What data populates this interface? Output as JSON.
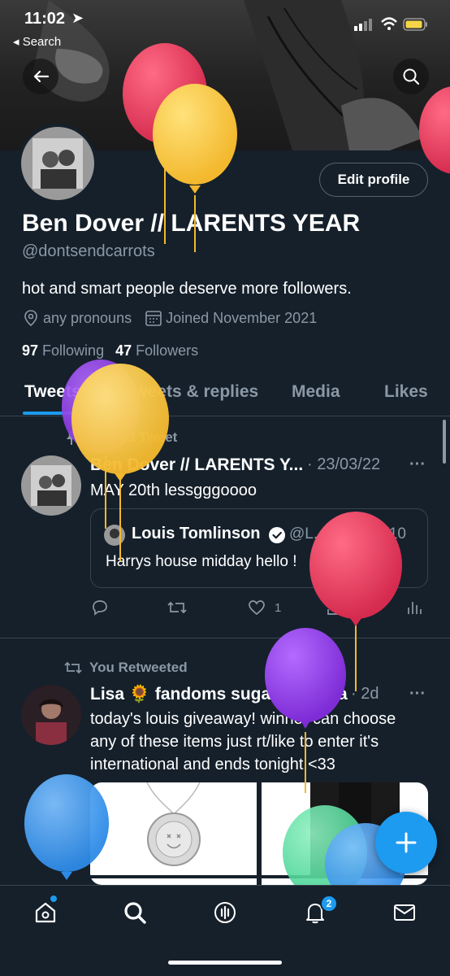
{
  "status": {
    "time": "11:02",
    "back_label": "◂ Search"
  },
  "profile": {
    "edit_button": "Edit profile",
    "name": "Ben Dover // LARENTS YEAR",
    "handle": "@dontsendcarrots",
    "bio": "hot and smart people deserve more followers.",
    "location": "any pronouns",
    "joined": "Joined November 2021",
    "following_count": "97",
    "following_label": "Following",
    "followers_count": "47",
    "followers_label": "Followers"
  },
  "tabs": [
    "Tweets",
    "Tweets & replies",
    "Media",
    "Likes"
  ],
  "tweets": [
    {
      "context": "Pinned Tweet",
      "author": "Ben Dover // LARENTS Y...",
      "date": "· 23/03/22",
      "text": "MAY 20th lessgggoooo",
      "quote": {
        "author": "Louis Tomlinson",
        "handle": "@L...",
        "date": "07/12/10",
        "text": "Harrys house midday hello !"
      },
      "like_count": "1"
    },
    {
      "context": "You Retweeted",
      "author": "Lisa 🌻 fandoms sugar momma",
      "date": "· 2d",
      "text": "today's louis giveaway! winner can choose any of these items just rt/like to enter it's international and ends tonight <33"
    }
  ],
  "nav": {
    "notification_badge": "2"
  },
  "colors": {
    "accent": "#1d9bf0",
    "background": "#15202b",
    "muted": "#8b98a5",
    "divider": "#38444d"
  }
}
